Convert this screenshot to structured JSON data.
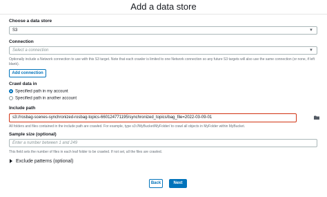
{
  "page": {
    "title": "Add a data store"
  },
  "data_store": {
    "label": "Choose a data store",
    "value": "S3"
  },
  "connection": {
    "label": "Connection",
    "placeholder": "Select a connection",
    "hint": "Optionally include a Network connection to use with this S3 target. Note that each crawler is limited to one Network connection so any future S3 targets will also use the same connection (or none, if left blank).",
    "add_button": "Add connection"
  },
  "crawl": {
    "label": "Crawl data in",
    "options": [
      {
        "label": "Specified path in my account",
        "selected": true
      },
      {
        "label": "Specified path in another account",
        "selected": false
      }
    ]
  },
  "include_path": {
    "label": "Include path",
    "value": "s3://rosbag-scenes-synchronized-rosbag-topics-660124771195/synchronized_topics/bag_file=2022-03-09-01",
    "hint": "All folders and files contained in the include path are crawled. For example, type s3://MyBucket/MyFolder/ to crawl all objects in MyFolder within MyBucket.",
    "icon": "folder-icon"
  },
  "sample_size": {
    "label": "Sample size (optional)",
    "placeholder": "Enter a number between 1 and 249",
    "hint": "This field sets the number of files in each leaf folder to be crawled. If not set, all the files are crawled."
  },
  "exclude": {
    "label": "Exclude patterns (optional)"
  },
  "footer": {
    "back_label": "Back",
    "next_label": "Next"
  },
  "colors": {
    "accent": "#0073bb",
    "highlight_border": "#d13212"
  }
}
